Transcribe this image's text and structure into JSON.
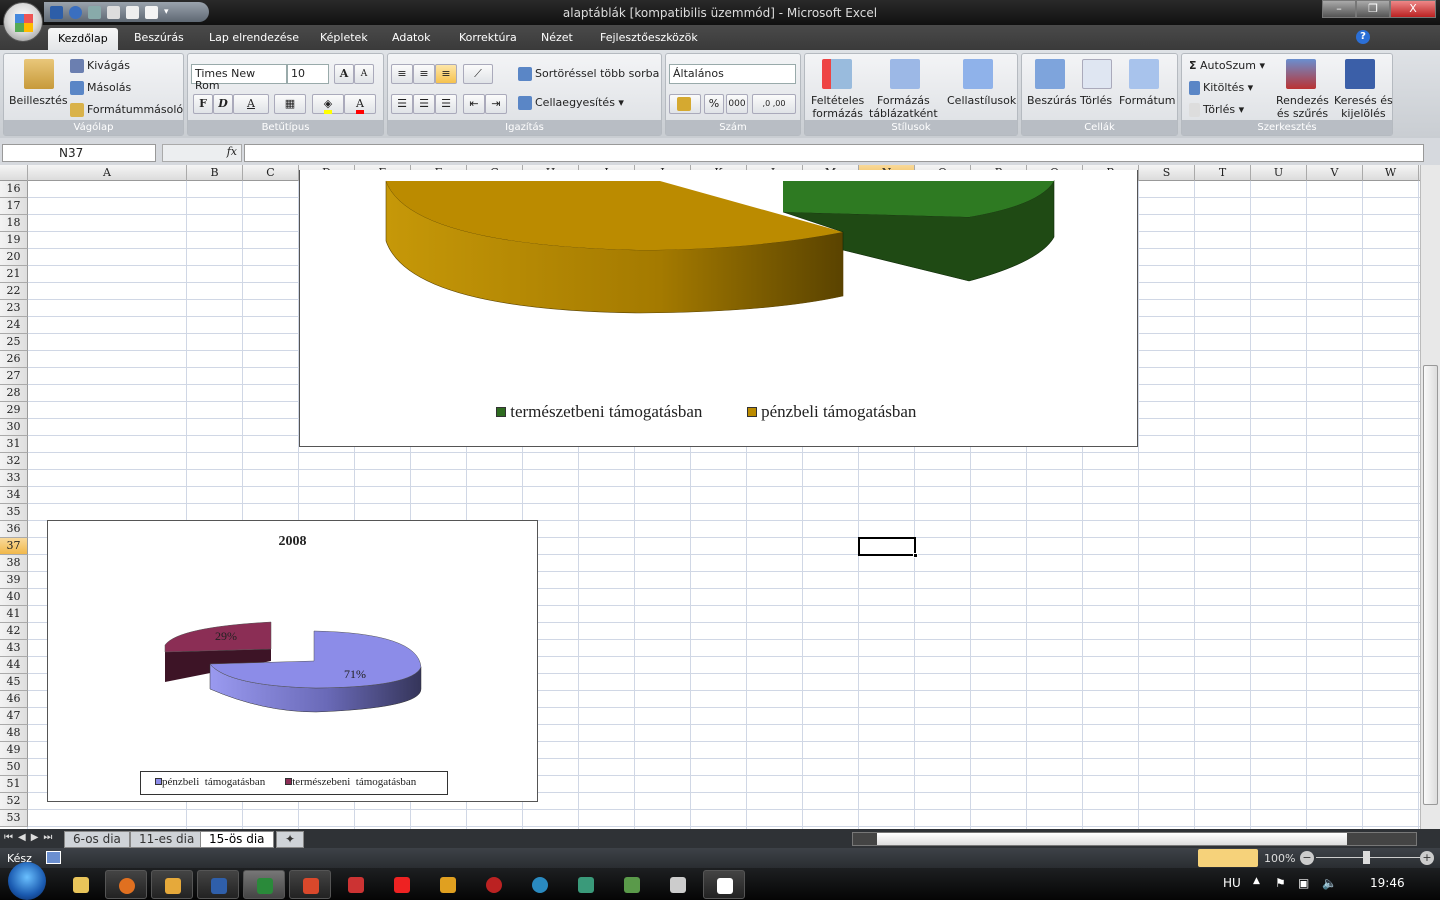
{
  "window": {
    "title": "alaptáblák  [kompatibilis üzemmód] - Microsoft Excel",
    "minimize": "–",
    "restore": "❐",
    "close": "X"
  },
  "ribbon_tabs": [
    "Kezdőlap",
    "Beszúrás",
    "Lap elrendezése",
    "Képletek",
    "Adatok",
    "Korrektúra",
    "Nézet",
    "Fejlesztőeszközök"
  ],
  "ribbon": {
    "clipboard": {
      "label": "Vágólap",
      "paste": "Beillesztés",
      "cut": "Kivágás",
      "copy": "Másolás",
      "format_painter": "Formátummásoló"
    },
    "font": {
      "label": "Betűtípus",
      "font_name": "Times New Rom",
      "font_size": "10",
      "bold": "F",
      "italic": "D",
      "underline": "A",
      "grow": "A",
      "shrink": "A",
      "font_color": "A",
      "fill_color": "#ffff00",
      "text_color": "#ff0000"
    },
    "alignment": {
      "label": "Igazítás",
      "wrap": "Sortöréssel több sorba",
      "merge": "Cellaegyesítés"
    },
    "number": {
      "label": "Szám",
      "format": "Általános",
      "percent": "%",
      "thousands": "000",
      "inc_dec": ",0 ,00"
    },
    "styles": {
      "label": "Stílusok",
      "conditional": [
        "Feltételes",
        "formázás"
      ],
      "as_table": [
        "Formázás",
        "táblázatként"
      ],
      "cell_styles": "Cellastílusok"
    },
    "cells": {
      "label": "Cellák",
      "insert": "Beszúrás",
      "delete": "Törlés",
      "format": "Formátum"
    },
    "editing": {
      "label": "Szerkesztés",
      "autosum": "AutoSzum",
      "fill": "Kitöltés",
      "clear": "Törlés",
      "sort": [
        "Rendezés",
        "és szűrés"
      ],
      "find": [
        "Keresés és",
        "kijelölés"
      ]
    }
  },
  "formula_bar": {
    "name_box": "N37",
    "fx": "fx",
    "value": ""
  },
  "columns": [
    "A",
    "B",
    "C",
    "D",
    "E",
    "F",
    "G",
    "H",
    "I",
    "J",
    "K",
    "L",
    "M",
    "N",
    "O",
    "P",
    "Q",
    "R",
    "S",
    "T",
    "U",
    "V",
    "W"
  ],
  "selected_column": "N",
  "rows": [
    16,
    17,
    18,
    19,
    20,
    21,
    22,
    23,
    24,
    25,
    26,
    27,
    28,
    29,
    30,
    31,
    32,
    33,
    34,
    35,
    36,
    37,
    38,
    39,
    40,
    41,
    42,
    43,
    44,
    45,
    46,
    47,
    48,
    49,
    50,
    51,
    52,
    53
  ],
  "selected_row": 37,
  "chart_data": [
    {
      "type": "pie",
      "subtype": "3d-exploded",
      "title": "",
      "legend_position": "bottom",
      "legend": [
        "természetbeni támogatásban",
        "pénzbeli támogatásban"
      ],
      "colors": {
        "természetbeni támogatásban": "#2e6b1f",
        "pénzbeli támogatásban": "#bb8b00"
      }
    },
    {
      "type": "pie",
      "subtype": "3d-exploded",
      "title": "2008",
      "legend_position": "bottom",
      "categories": [
        "pénzbeli  támogatásban",
        "természebeni  támogatásban"
      ],
      "values": [
        71,
        29
      ],
      "data_labels": [
        "71%",
        "29%"
      ],
      "colors": {
        "pénzbeli  támogatásban": "#8c8ce8",
        "természebeni  támogatásban": "#8b2e55"
      }
    }
  ],
  "sheet_tabs": [
    "6-os dia",
    "11-es dia",
    "15-ös dia"
  ],
  "active_sheet": "15-ös dia",
  "status": {
    "ready": "Kész",
    "zoom": "100%"
  },
  "taskbar": {
    "language": "HU",
    "clock": "19:46"
  }
}
